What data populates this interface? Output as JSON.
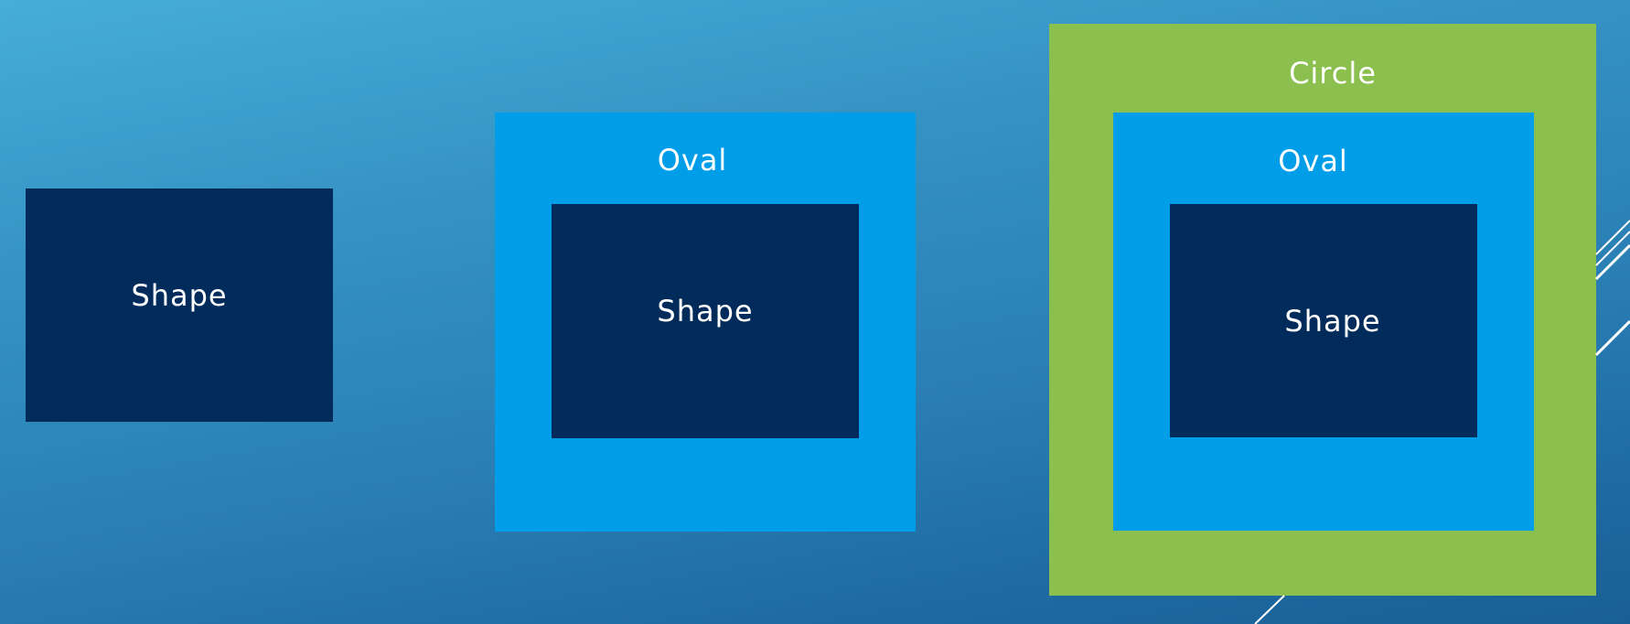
{
  "diagram": {
    "title": "",
    "groups": [
      {
        "shape_label": "Shape"
      },
      {
        "oval_label": "Oval",
        "shape_label": "Shape"
      },
      {
        "circle_label": "Circle",
        "oval_label": "Oval",
        "shape_label": "Shape"
      }
    ]
  },
  "colors": {
    "background_top": "#46add8",
    "background_bottom": "#195f95",
    "shape": "#002b5a",
    "oval": "#009de8",
    "circle": "#8bc04f",
    "text": "#ffffff"
  }
}
